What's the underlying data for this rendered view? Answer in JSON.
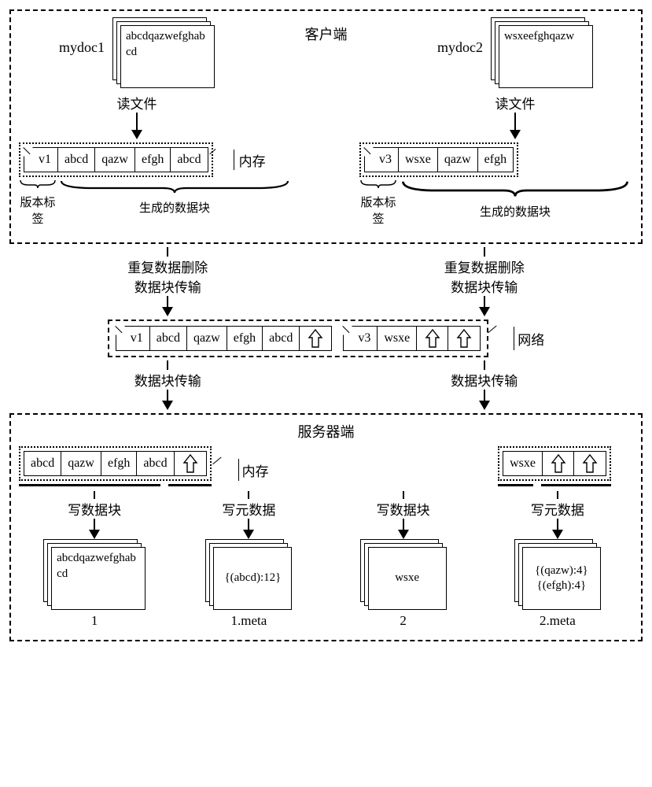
{
  "client": {
    "title": "客户端",
    "doc1": {
      "name": "mydoc1",
      "content": "abcdqazwefghabcd"
    },
    "doc2": {
      "name": "mydoc2",
      "content": "wsxeefghqazw"
    },
    "read_file": "读文件",
    "memory_label": "内存",
    "mem1": {
      "tag": "v1",
      "blocks": [
        "abcd",
        "qazw",
        "efgh",
        "abcd"
      ]
    },
    "mem2": {
      "tag": "v3",
      "blocks": [
        "wsxe",
        "qazw",
        "efgh"
      ]
    },
    "version_tag_label": "版本标签",
    "gen_blocks_label": "生成的数据块"
  },
  "mid": {
    "dedup_line1": "重复数据删除",
    "dedup_line2": "数据块传输",
    "network_label": "网络",
    "net_left": {
      "tag": "v1",
      "blocks": [
        "abcd",
        "qazw",
        "efgh",
        "abcd"
      ],
      "placeholders": 1
    },
    "net_right": {
      "tag": "v3",
      "blocks": [
        "wsxe"
      ],
      "placeholders": 2
    },
    "block_transfer": "数据块传输"
  },
  "server": {
    "title": "服务器端",
    "memory_label": "内存",
    "mem_left": {
      "blocks": [
        "abcd",
        "qazw",
        "efgh",
        "abcd"
      ],
      "placeholders": 1
    },
    "mem_right": {
      "blocks": [
        "wsxe"
      ],
      "placeholders": 2
    },
    "write_block": "写数据块",
    "write_meta": "写元数据",
    "out1": {
      "name": "1",
      "content": "abcdqazwefghabcd"
    },
    "out2": {
      "name": "1.meta",
      "content": "{(abcd):12}"
    },
    "out3": {
      "name": "2",
      "content": "wsxe"
    },
    "out4": {
      "name": "2.meta",
      "lines": [
        "{(qazw):4}",
        "{(efgh):4}"
      ]
    }
  }
}
